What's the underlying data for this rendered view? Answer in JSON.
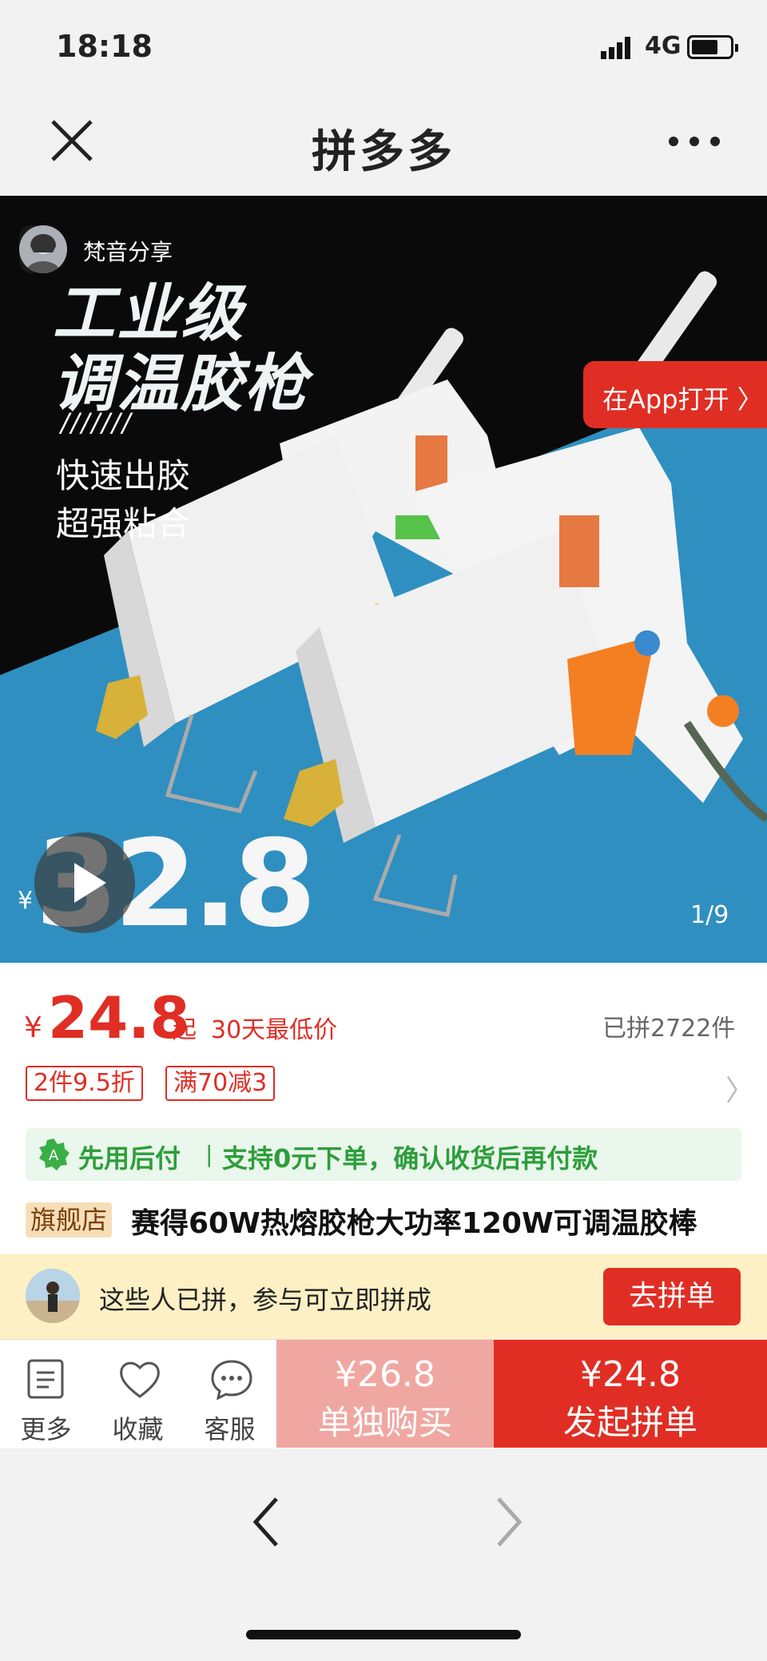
{
  "status_bar": {
    "time": "18:18",
    "network": "4G"
  },
  "nav": {
    "title": "拼多多",
    "close_icon": "close-icon",
    "more_icon": "more-dots-icon"
  },
  "hero": {
    "sharer_name": "梵音分享",
    "open_app_label": "在App打开",
    "headline_line1": "工业级",
    "headline_line2": "调温胶枪",
    "slashes": "///////",
    "sub_line1": "快速出胶",
    "sub_line2": "超强粘合",
    "promo_currency": "¥",
    "promo_price": "32.8",
    "pager": "1/9",
    "colors": {
      "background": "#0a0a0a",
      "stripe": "#2f8fc0"
    }
  },
  "product": {
    "currency": "¥",
    "price": "24.8",
    "price_suffix": "起",
    "lowest_tag": "30天最低价",
    "sold": "已拼2722件",
    "tags": [
      "2件9.5折",
      "满70减3"
    ],
    "pay_later_title": "先用后付",
    "pay_later_sep": "|",
    "pay_later_desc": "支持0元下单，确认收货后再付款",
    "store_badge": "旗舰店",
    "title": "赛得60W热熔胶枪大功率120W可调温胶棒"
  },
  "group_bar": {
    "text": "这些人已拼，参与可立即拼成",
    "button": "去拼单"
  },
  "actions": {
    "more": "更多",
    "favorite": "收藏",
    "service": "客服",
    "solo_price": "¥26.8",
    "solo_label": "单独购买",
    "group_price": "¥24.8",
    "group_label": "发起拼单"
  },
  "colors": {
    "brand_red": "#e02e24",
    "solo_pink": "#f0a7a2",
    "pay_later_green": "#2d9e3b",
    "group_bar_bg": "#fdf0c4"
  }
}
